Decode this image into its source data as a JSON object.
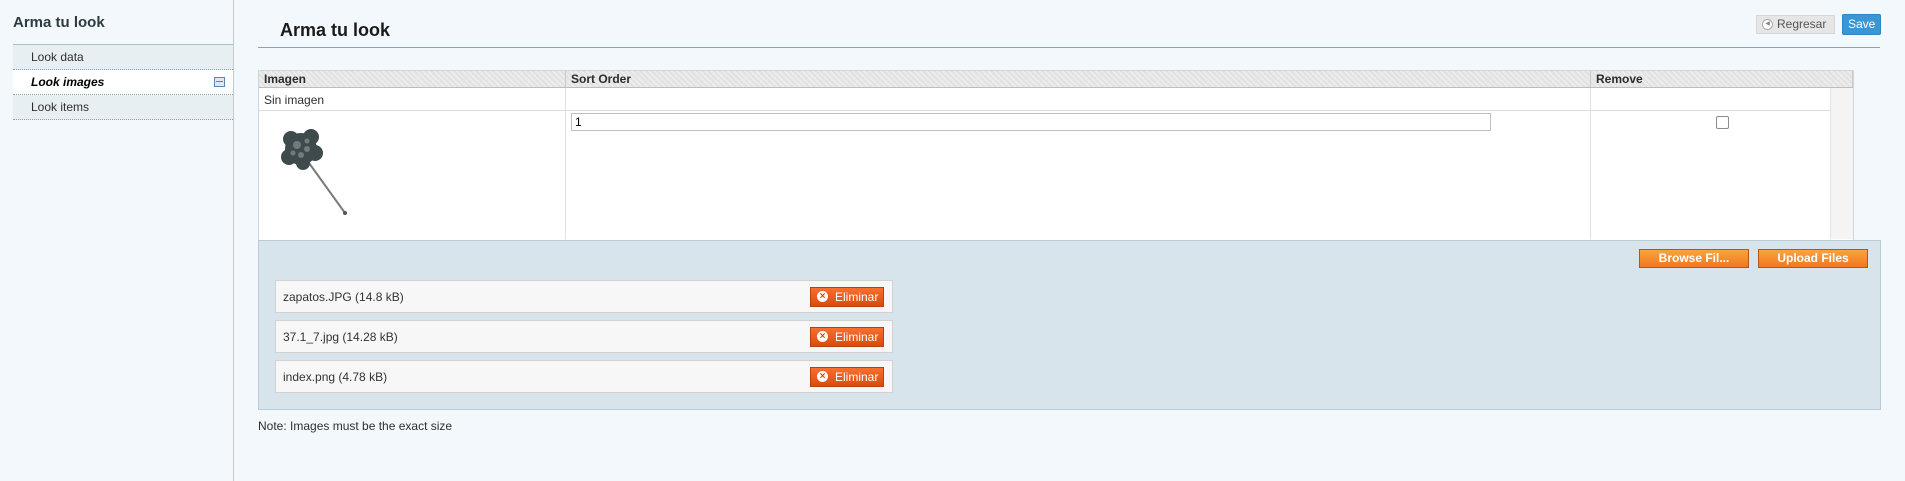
{
  "sidebar": {
    "title": "Arma tu look",
    "tabs": [
      {
        "label": "Look data"
      },
      {
        "label": "Look images"
      },
      {
        "label": "Look items"
      }
    ]
  },
  "header": {
    "title": "Arma tu look",
    "back_label": "Regresar",
    "save_label": "Save"
  },
  "grid": {
    "columns": [
      "Imagen",
      "Sort Order",
      "Remove"
    ],
    "empty_row_text": "Sin imagen",
    "rows": [
      {
        "sort_order": "1",
        "remove": false
      }
    ]
  },
  "upload": {
    "browse_label": "Browse Fil...",
    "upload_label": "Upload Files",
    "files": [
      {
        "name": "zapatos.JPG (14.8 kB)",
        "delete_label": "Eliminar"
      },
      {
        "name": "37.1_7.jpg (14.28 kB)",
        "delete_label": "Eliminar"
      },
      {
        "name": "index.png (4.78 kB)",
        "delete_label": "Eliminar"
      }
    ]
  },
  "note": "Note: Images must be the exact size",
  "colors": {
    "accent": "#3b96d4",
    "orange": "#f0781e",
    "panel": "#d7e4ec"
  }
}
